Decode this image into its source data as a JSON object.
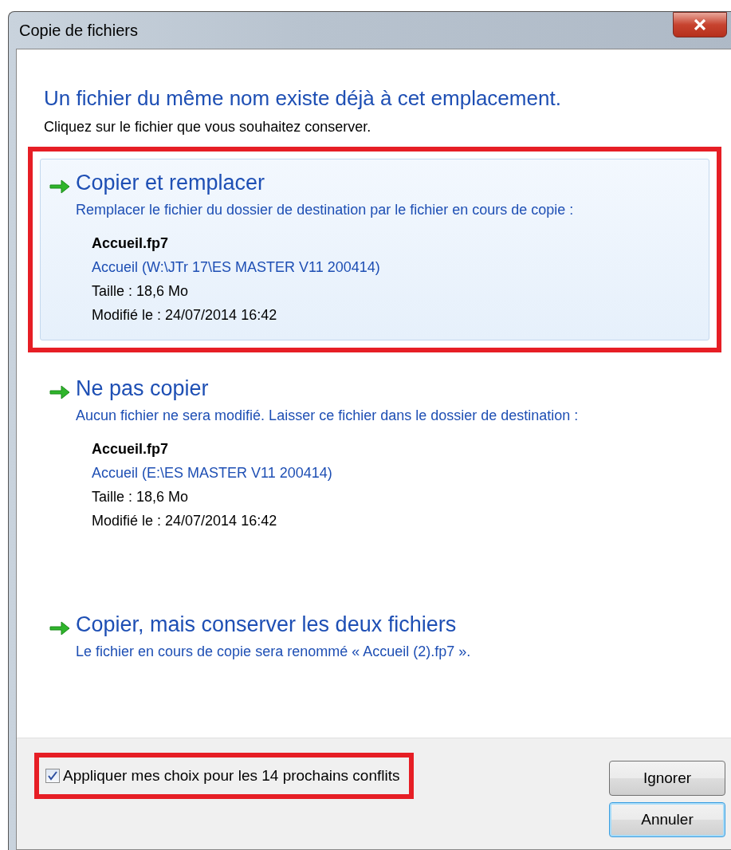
{
  "window": {
    "title": "Copie de fichiers"
  },
  "heading": "Un fichier du même nom existe déjà à cet emplacement.",
  "instruction": "Cliquez sur le fichier que vous souhaitez conserver.",
  "options": [
    {
      "title": "Copier et remplacer",
      "description": "Remplacer le fichier du dossier de destination par le fichier en cours de copie :",
      "selected": true,
      "highlighted": true,
      "file": {
        "name": "Accueil.fp7",
        "location": "Accueil (W:\\JTr 17\\ES MASTER V11 200414)",
        "size": "Taille : 18,6 Mo",
        "modified": "Modifié le : 24/07/2014 16:42"
      }
    },
    {
      "title": "Ne pas copier",
      "description": "Aucun fichier ne sera modifié. Laisser ce fichier dans le dossier de destination :",
      "selected": false,
      "highlighted": false,
      "file": {
        "name": "Accueil.fp7",
        "location": "Accueil (E:\\ES MASTER V11 200414)",
        "size": "Taille : 18,6 Mo",
        "modified": "Modifié le : 24/07/2014 16:42"
      }
    },
    {
      "title": "Copier, mais conserver les deux fichiers",
      "description": "Le fichier en cours de copie sera renommé « Accueil (2).fp7 ».",
      "selected": false,
      "highlighted": false
    }
  ],
  "apply_all": {
    "label": "Appliquer mes choix pour les 14 prochains conflits",
    "checked": true,
    "highlighted": true
  },
  "buttons": [
    {
      "label": "Ignorer",
      "default": false
    },
    {
      "label": "Annuler",
      "default": true
    }
  ]
}
